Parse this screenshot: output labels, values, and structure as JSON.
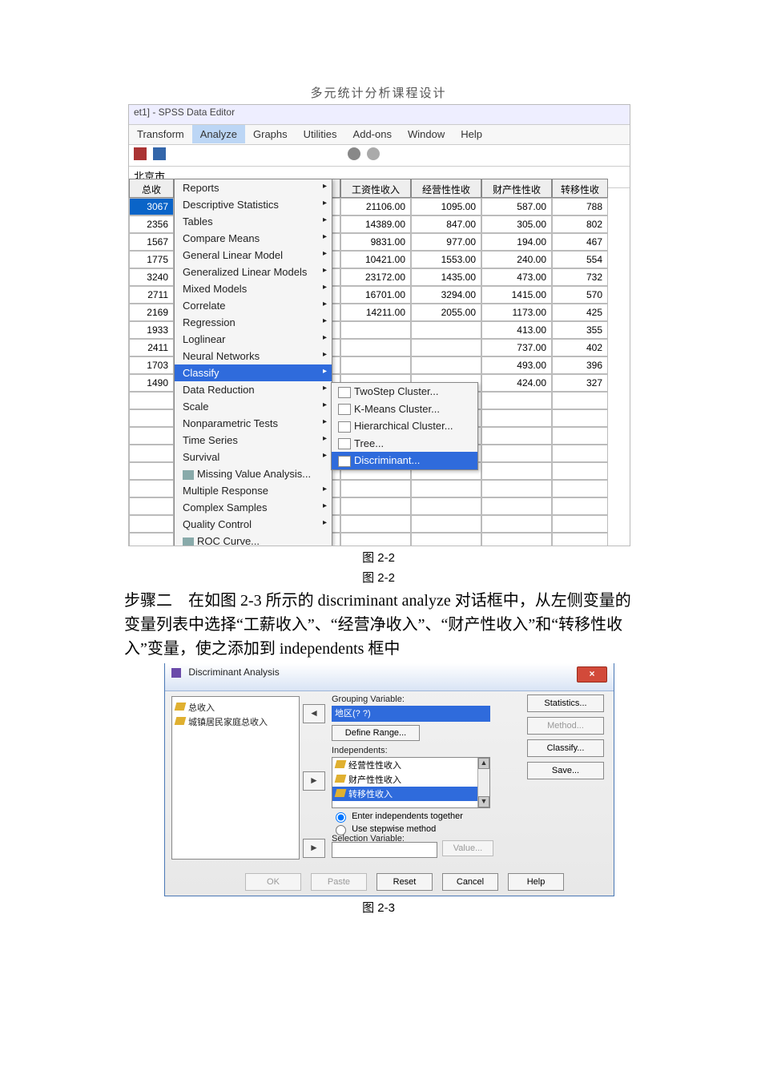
{
  "doc_title": "多元统计分析课程设计",
  "fig1": {
    "window_title": "et1] - SPSS Data Editor",
    "menubar": [
      "Transform",
      "Analyze",
      "Graphs",
      "Utilities",
      "Add-ons",
      "Window",
      "Help"
    ],
    "menubar_hl": "Analyze",
    "addr": "北京市",
    "header_cols": [
      "总收",
      "",
      "工资性收入",
      "经营性性收",
      "财产性性收",
      "转移性收"
    ],
    "rows": [
      {
        "a": "3067",
        "c": "21106.00",
        "d": "1095.00",
        "e": "587.00",
        "f": "788",
        "sel": true
      },
      {
        "a": "2356",
        "c": "14389.00",
        "d": "847.00",
        "e": "305.00",
        "f": "802"
      },
      {
        "a": "1567",
        "c": "9831.00",
        "d": "977.00",
        "e": "194.00",
        "f": "467"
      },
      {
        "a": "1775",
        "c": "10421.00",
        "d": "1553.00",
        "e": "240.00",
        "f": "554"
      },
      {
        "a": "3240",
        "c": "23172.00",
        "d": "1435.00",
        "e": "473.00",
        "f": "732"
      },
      {
        "a": "2711",
        "c": "16701.00",
        "d": "3294.00",
        "e": "1415.00",
        "f": "570"
      },
      {
        "a": "2169",
        "c": "14211.00",
        "d": "2055.00",
        "e": "1173.00",
        "f": "425"
      },
      {
        "a": "1933",
        "c": "",
        "d": "",
        "e": "413.00",
        "f": "355"
      },
      {
        "a": "2411",
        "c": "",
        "d": "",
        "e": "737.00",
        "f": "402"
      },
      {
        "a": "1703",
        "c": "",
        "d": "",
        "e": "493.00",
        "f": "396"
      },
      {
        "a": "1490",
        "c": "",
        "d": "",
        "e": "424.00",
        "f": "327"
      }
    ],
    "analyze_menu": [
      {
        "label": "Reports",
        "sub": true
      },
      {
        "label": "Descriptive Statistics",
        "sub": true
      },
      {
        "label": "Tables",
        "sub": true
      },
      {
        "label": "Compare Means",
        "sub": true
      },
      {
        "label": "General Linear Model",
        "sub": true
      },
      {
        "label": "Generalized Linear Models",
        "sub": true
      },
      {
        "label": "Mixed Models",
        "sub": true
      },
      {
        "label": "Correlate",
        "sub": true
      },
      {
        "label": "Regression",
        "sub": true
      },
      {
        "label": "Loglinear",
        "sub": true
      },
      {
        "label": "Neural Networks",
        "sub": true
      },
      {
        "label": "Classify",
        "sub": true,
        "hl": true
      },
      {
        "label": "Data Reduction",
        "sub": true
      },
      {
        "label": "Scale",
        "sub": true
      },
      {
        "label": "Nonparametric Tests",
        "sub": true
      },
      {
        "label": "Time Series",
        "sub": true
      },
      {
        "label": "Survival",
        "sub": true
      },
      {
        "label": "Missing Value Analysis...",
        "sub": false,
        "icon": true
      },
      {
        "label": "Multiple Response",
        "sub": true
      },
      {
        "label": "Complex Samples",
        "sub": true
      },
      {
        "label": "Quality Control",
        "sub": true
      },
      {
        "label": "ROC Curve...",
        "sub": false,
        "icon": true
      }
    ],
    "classify_submenu": [
      {
        "label": "TwoStep Cluster..."
      },
      {
        "label": "K-Means Cluster..."
      },
      {
        "label": "Hierarchical Cluster..."
      },
      {
        "label": "Tree..."
      },
      {
        "label": "Discriminant...",
        "hl": true
      }
    ],
    "caption_a": "图 2-2",
    "caption_b": "图 2-2"
  },
  "paragraph": "步骤二　在如图 2-3 所示的 discriminant analyze 对话框中，从左侧变量的变量列表中选择“工薪收入”、“经营净收入”、“财产性收入”和“转移性收入”变量，使之添加到 independents 框中",
  "fig2": {
    "title": "Discriminant Analysis",
    "varlist": [
      "总收入",
      "城镇居民家庭总收入"
    ],
    "grouping_label": "Grouping Variable:",
    "grouping_value": "地区(? ?)",
    "define_btn": "Define Range...",
    "independents_label": "Independents:",
    "independents": [
      {
        "label": "经营性性收入"
      },
      {
        "label": "财产性性收入"
      },
      {
        "label": "转移性收入",
        "sel": true
      }
    ],
    "radio1": "Enter independents together",
    "radio2": "Use stepwise method",
    "selection_label": "Selection Variable:",
    "value_btn": "Value...",
    "right_buttons": [
      {
        "label": "Statistics..."
      },
      {
        "label": "Method...",
        "disabled": true
      },
      {
        "label": "Classify..."
      },
      {
        "label": "Save..."
      }
    ],
    "bottom_buttons": [
      {
        "label": "OK",
        "disabled": true
      },
      {
        "label": "Paste",
        "disabled": true
      },
      {
        "label": "Reset"
      },
      {
        "label": "Cancel"
      },
      {
        "label": "Help"
      }
    ],
    "caption": "图 2-3"
  }
}
